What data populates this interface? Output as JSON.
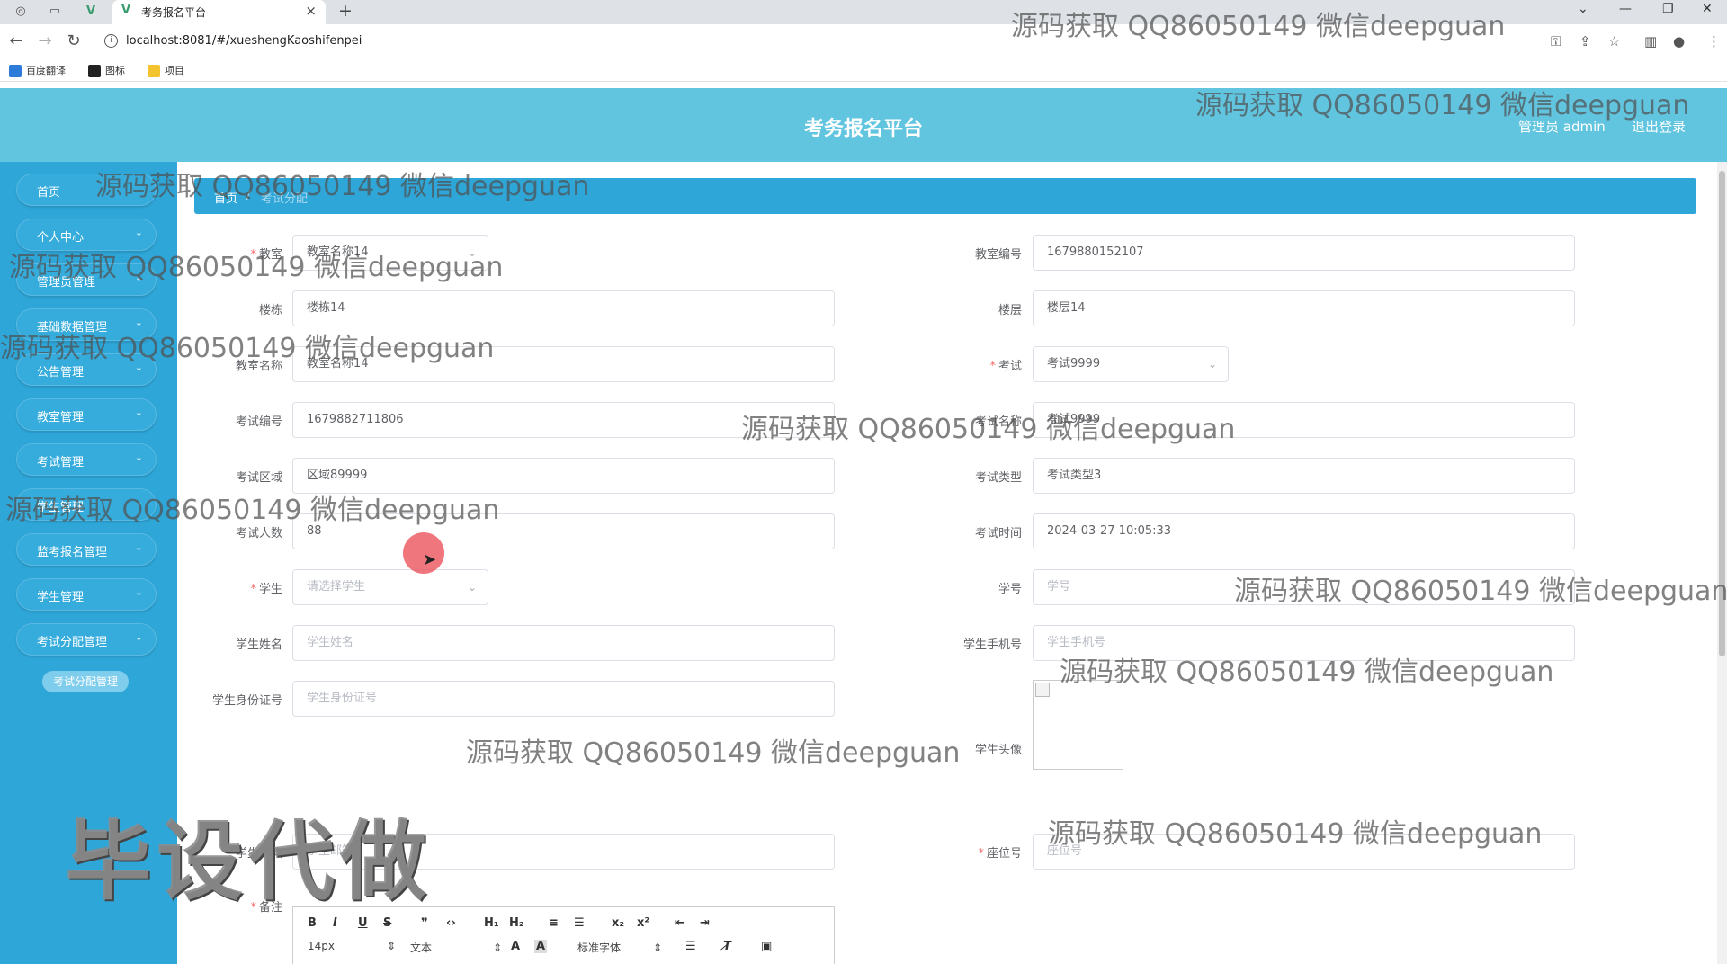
{
  "browser": {
    "tab_title": "考务报名平台",
    "url": "localhost:8081/#/xueshengKaoshifenpei",
    "bookmarks": [
      "百度翻译",
      "图标",
      "项目"
    ]
  },
  "header": {
    "title": "考务报名平台",
    "user": "管理员 admin",
    "logout": "退出登录"
  },
  "sidebar": {
    "items": [
      {
        "label": "首页",
        "has_children": false
      },
      {
        "label": "个人中心",
        "has_children": true
      },
      {
        "label": "管理员管理",
        "has_children": true
      },
      {
        "label": "基础数据管理",
        "has_children": true
      },
      {
        "label": "公告管理",
        "has_children": true
      },
      {
        "label": "教室管理",
        "has_children": true
      },
      {
        "label": "考试管理",
        "has_children": true
      },
      {
        "label": "学生管理",
        "has_children": true
      },
      {
        "label": "监考报名管理",
        "has_children": true
      },
      {
        "label": "学生管理",
        "has_children": true
      },
      {
        "label": "考试分配管理",
        "has_children": true
      }
    ],
    "sub_item": "考试分配管理"
  },
  "breadcrumb": {
    "home": "首页",
    "separator": "/",
    "current": "考试分配"
  },
  "form": {
    "jiaoshi": {
      "label": "教室",
      "value": "教室名称14",
      "required": true
    },
    "jiaoshi_uuid": {
      "label": "教室编号",
      "value": "1679880152107"
    },
    "loudong": {
      "label": "楼栋",
      "value": "楼栋14"
    },
    "louceng": {
      "label": "楼层",
      "value": "楼层14"
    },
    "jiaoshi_name": {
      "label": "教室名称",
      "value": "教室名称14"
    },
    "kaoshi": {
      "label": "考试",
      "value": "考试9999",
      "required": true
    },
    "kaoshi_uuid": {
      "label": "考试编号",
      "value": "1679882711806"
    },
    "kaoshi_name": {
      "label": "考试名称",
      "value": "考试9999"
    },
    "kaoshi_area": {
      "label": "考试区域",
      "value": "区域89999"
    },
    "kaoshi_type": {
      "label": "考试类型",
      "value": "考试类型3"
    },
    "kaoshi_num": {
      "label": "考试人数",
      "value": "88"
    },
    "kaoshi_time": {
      "label": "考试时间",
      "value": "2024-03-27 10:05:33"
    },
    "xuesheng": {
      "label": "学生",
      "placeholder": "请选择学生",
      "required": true
    },
    "xuesheng_uuid": {
      "label": "学号",
      "placeholder": "学号"
    },
    "xuesheng_name": {
      "label": "学生姓名",
      "placeholder": "学生姓名"
    },
    "xuesheng_phone": {
      "label": "学生手机号",
      "placeholder": "学生手机号"
    },
    "xuesheng_idnum": {
      "label": "学生身份证号",
      "placeholder": "学生身份证号"
    },
    "xuesheng_photo": {
      "label": "学生头像"
    },
    "xuesheng_email": {
      "label": "学生邮箱",
      "placeholder": "学生邮箱"
    },
    "zuowei": {
      "label": "座位号",
      "placeholder": "座位号",
      "required": true
    },
    "beizhu": {
      "label": "备注",
      "required": true
    }
  },
  "editor": {
    "buttons": [
      "B",
      "I",
      "U",
      "S",
      "❞",
      "‹›",
      "H₁",
      "H₂",
      "≡",
      "☰",
      "x₂",
      "x²",
      "⇤",
      "⇥"
    ],
    "font_size": "14px",
    "text_style": "文本",
    "font_family": "标准字体"
  },
  "watermark": {
    "text": "源码获取 QQ86050149 微信deepguan",
    "big_text": "毕设代做"
  },
  "colors": {
    "header": "#62c5e0",
    "sidebar": "#2ea6d8",
    "required": "#f56c6c"
  }
}
